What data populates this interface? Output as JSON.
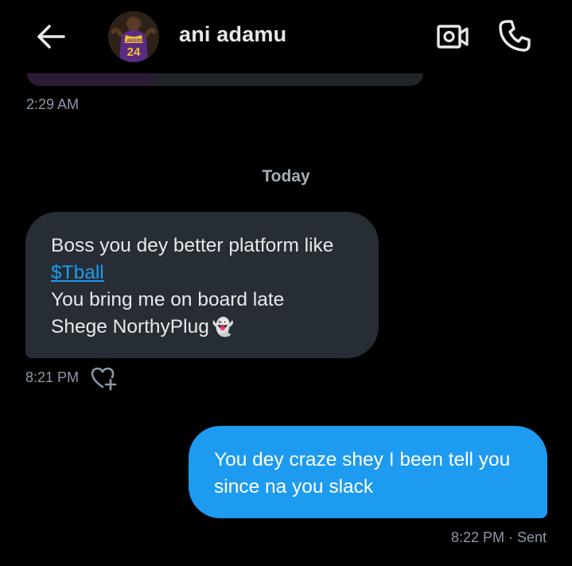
{
  "header": {
    "contact_name": "ani adamu",
    "avatar_jersey_number": "24",
    "avatar_jersey_text": "LAKERS",
    "back_icon": "arrow-left-icon",
    "video_icon": "video-camera-icon",
    "call_icon": "phone-icon"
  },
  "previous_message": {
    "time": "2:29 AM"
  },
  "date_divider": "Today",
  "messages": [
    {
      "direction": "incoming",
      "lines": [
        "Boss you dey better platform like",
        "$Tball",
        "You bring me on board late",
        "Shege NorthyPlug"
      ],
      "emoji": "👻",
      "time": "8:21 PM",
      "react_icon": "heart-plus-icon"
    },
    {
      "direction": "outgoing",
      "lines": [
        "You dey craze shey I been tell you",
        "since na you slack"
      ],
      "status": "8:22 PM · Sent"
    }
  ],
  "colors": {
    "background": "#000000",
    "incoming_bubble": "#262d34",
    "outgoing_bubble": "#1d9bf0",
    "link": "#1d9bf0",
    "muted_text": "#8b98a5"
  }
}
